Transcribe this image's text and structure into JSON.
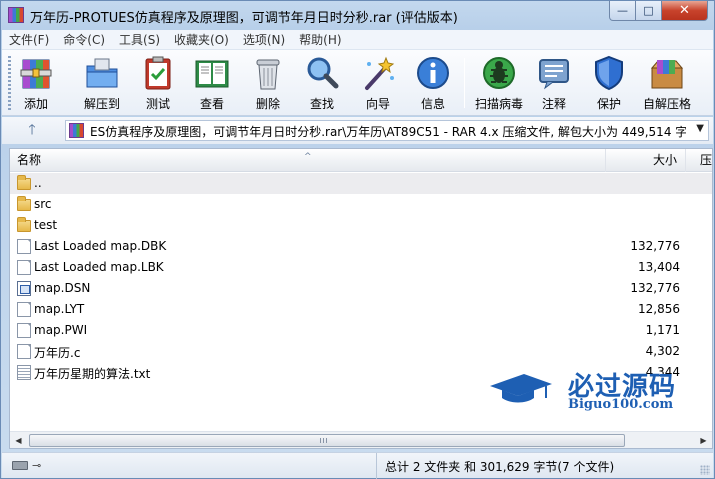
{
  "window": {
    "title": "万年历-PROTUES仿真程序及原理图，可调节年月日时分秒.rar (评估版本)",
    "buttons": {
      "minimize": "—",
      "maximize": "□",
      "close": "✕"
    }
  },
  "menu": [
    "文件(F)",
    "命令(C)",
    "工具(S)",
    "收藏夹(O)",
    "选项(N)",
    "帮助(H)"
  ],
  "toolbar": [
    {
      "label": "添加",
      "icon": "add-archive-icon"
    },
    {
      "label": "解压到",
      "icon": "extract-to-folder-icon"
    },
    {
      "label": "测试",
      "icon": "test-clipboard-icon"
    },
    {
      "label": "查看",
      "icon": "view-book-icon"
    },
    {
      "label": "删除",
      "icon": "delete-trash-icon"
    },
    {
      "label": "查找",
      "icon": "find-magnifier-icon"
    },
    {
      "label": "向导",
      "icon": "wizard-wand-icon"
    },
    {
      "label": "信息",
      "icon": "info-icon"
    },
    {
      "label": "扫描病毒",
      "icon": "virus-scan-icon"
    },
    {
      "label": "注释",
      "icon": "comment-icon"
    },
    {
      "label": "保护",
      "icon": "protect-shield-icon"
    },
    {
      "label": "自解压格",
      "icon": "sfx-box-icon"
    }
  ],
  "pathbar": {
    "up_symbol": "🡑",
    "path": "ES仿真程序及原理图，可调节年月日时分秒.rar\\万年历\\AT89C51 - RAR 4.x 压缩文件, 解包大小为 449,514 字节"
  },
  "columns": {
    "name": "名称",
    "size": "大小",
    "packed": "压"
  },
  "files": [
    {
      "name": "..",
      "size": "",
      "type": "parent"
    },
    {
      "name": "src",
      "size": "",
      "type": "folder"
    },
    {
      "name": "test",
      "size": "",
      "type": "folder"
    },
    {
      "name": "Last Loaded map.DBK",
      "size": "132,776",
      "type": "file"
    },
    {
      "name": "Last Loaded map.LBK",
      "size": "13,404",
      "type": "file"
    },
    {
      "name": "map.DSN",
      "size": "132,776",
      "type": "dsn"
    },
    {
      "name": "map.LYT",
      "size": "12,856",
      "type": "file"
    },
    {
      "name": "map.PWI",
      "size": "1,171",
      "type": "file"
    },
    {
      "name": "万年历.c",
      "size": "4,302",
      "type": "file"
    },
    {
      "name": "万年历星期的算法.txt",
      "size": "4,344",
      "type": "txt"
    }
  ],
  "watermark": {
    "title": "必过源码",
    "subtitle": "Biguo100.com"
  },
  "status": {
    "summary": "总计 2 文件夹 和 301,629 字节(7 个文件)"
  }
}
